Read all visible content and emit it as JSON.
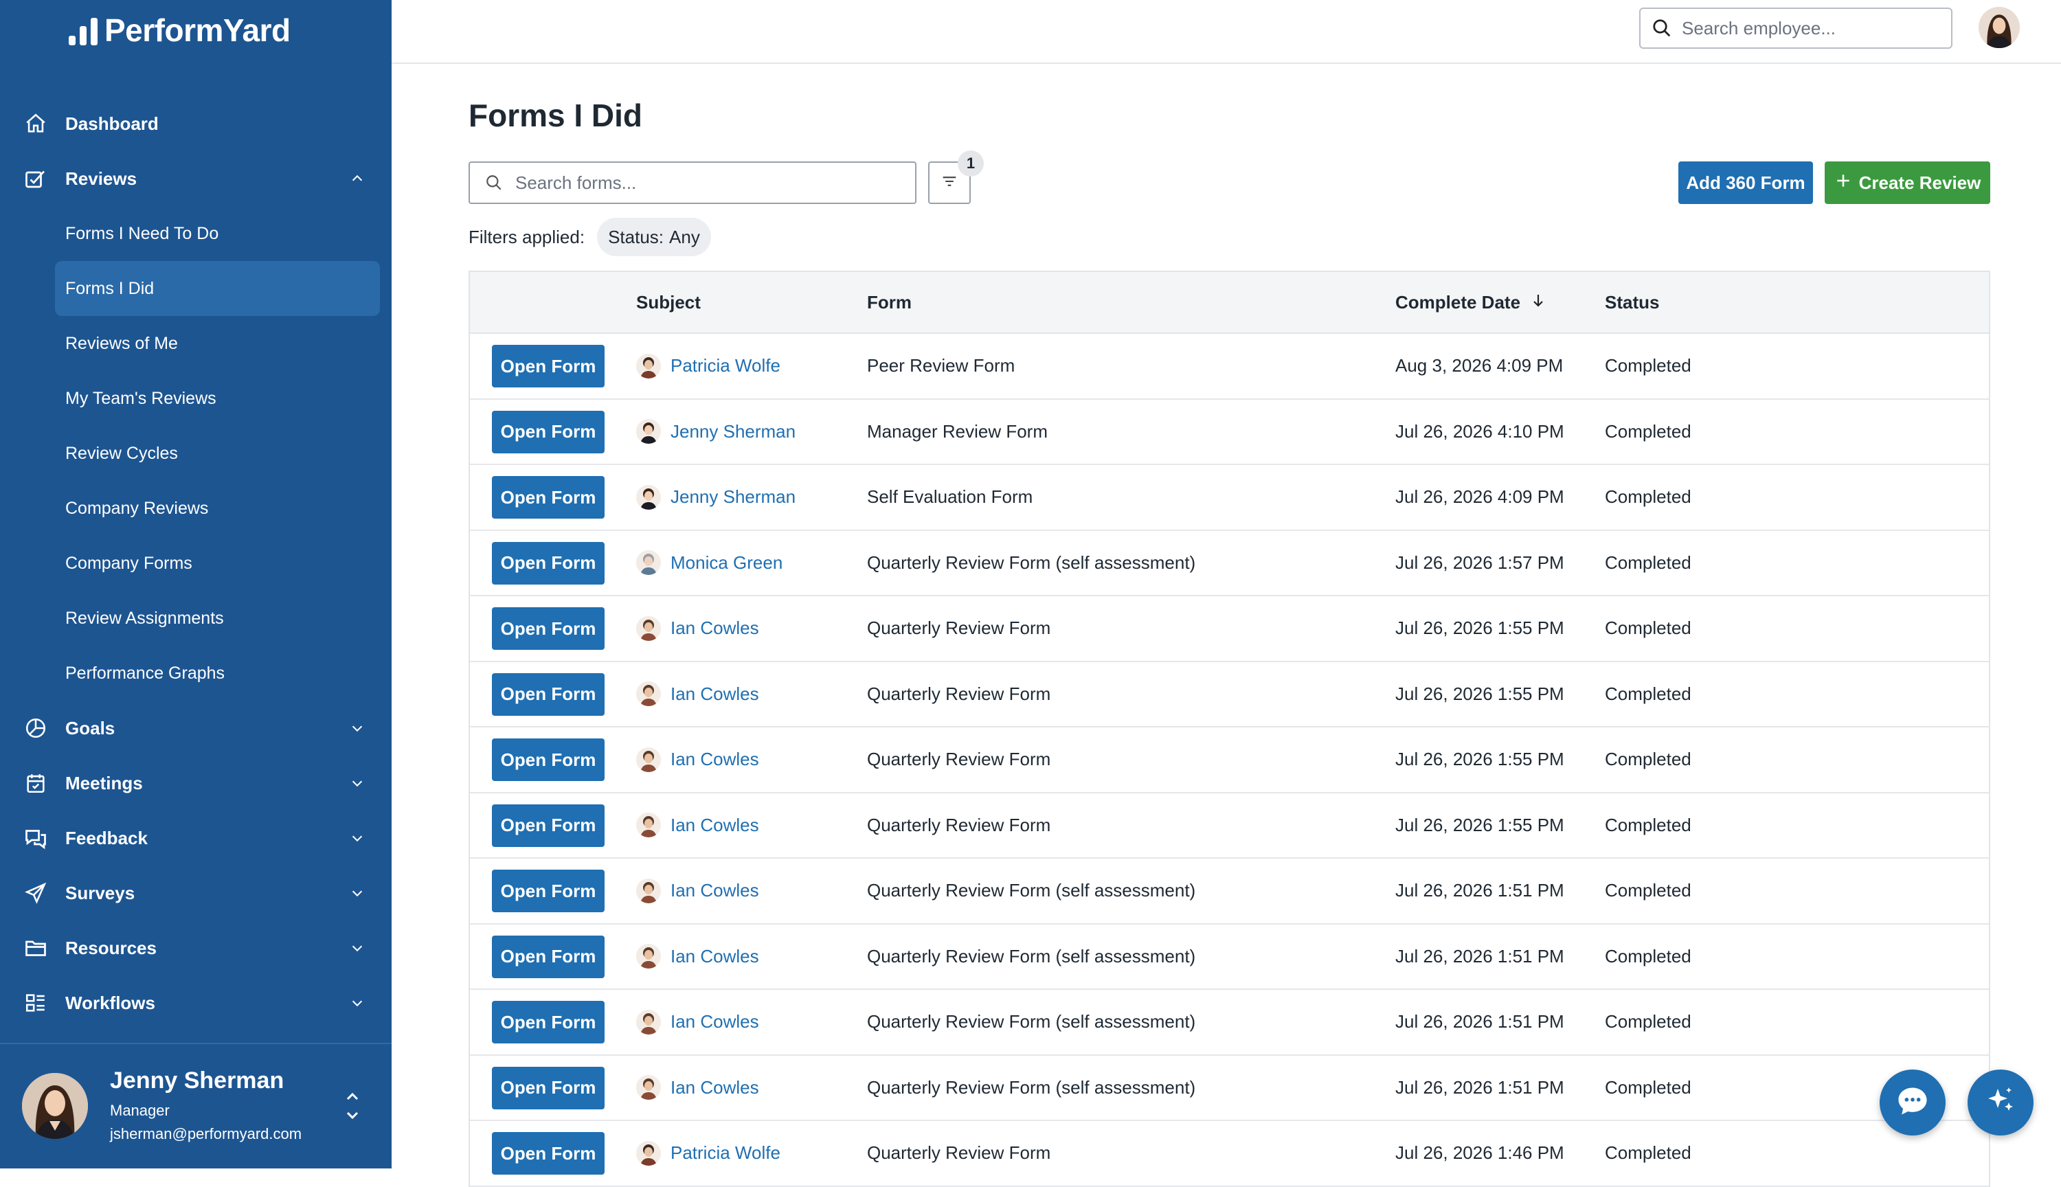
{
  "app": {
    "brand": "PerformYard"
  },
  "sidebar": {
    "items": [
      {
        "label": "Dashboard",
        "icon": "home-icon"
      },
      {
        "label": "Reviews",
        "icon": "reviews-icon",
        "expanded": true
      },
      {
        "label": "Goals",
        "icon": "goals-icon"
      },
      {
        "label": "Meetings",
        "icon": "calendar-icon"
      },
      {
        "label": "Feedback",
        "icon": "chat-icon"
      },
      {
        "label": "Surveys",
        "icon": "send-icon"
      },
      {
        "label": "Resources",
        "icon": "folder-icon"
      },
      {
        "label": "Workflows",
        "icon": "workflow-icon"
      }
    ],
    "reviews_sub": [
      "Forms I Need To Do",
      "Forms I Did",
      "Reviews of Me",
      "My Team's Reviews",
      "Review Cycles",
      "Company Reviews",
      "Company Forms",
      "Review Assignments",
      "Performance Graphs"
    ],
    "active_sub": "Forms I Did",
    "user": {
      "name": "Jenny Sherman",
      "role": "Manager",
      "email": "jsherman@performyard.com"
    }
  },
  "topbar": {
    "search_placeholder": "Search employee..."
  },
  "main": {
    "title": "Forms I Did",
    "search_placeholder": "Search forms...",
    "filter_count": "1",
    "add_360_label": "Add 360 Form",
    "create_review_label": "Create Review",
    "filters_applied_label": "Filters applied:",
    "filter_chip": {
      "key": "Status:",
      "value": "Any"
    }
  },
  "table": {
    "headers": {
      "subject": "Subject",
      "form": "Form",
      "complete_date": "Complete Date",
      "status": "Status"
    },
    "sort": {
      "column": "Complete Date",
      "direction": "descending"
    },
    "open_label": "Open Form",
    "rows": [
      {
        "subject": "Patricia Wolfe",
        "form": "Peer Review Form",
        "date": "Aug 3, 2026 4:09 PM",
        "status": "Completed"
      },
      {
        "subject": "Jenny Sherman",
        "form": "Manager Review Form",
        "date": "Jul 26, 2026 4:10 PM",
        "status": "Completed"
      },
      {
        "subject": "Jenny Sherman",
        "form": "Self Evaluation Form",
        "date": "Jul 26, 2026 4:09 PM",
        "status": "Completed"
      },
      {
        "subject": "Monica Green",
        "form": "Quarterly Review Form (self assessment)",
        "date": "Jul 26, 2026 1:57 PM",
        "status": "Completed"
      },
      {
        "subject": "Ian Cowles",
        "form": "Quarterly Review Form",
        "date": "Jul 26, 2026 1:55 PM",
        "status": "Completed"
      },
      {
        "subject": "Ian Cowles",
        "form": "Quarterly Review Form",
        "date": "Jul 26, 2026 1:55 PM",
        "status": "Completed"
      },
      {
        "subject": "Ian Cowles",
        "form": "Quarterly Review Form",
        "date": "Jul 26, 2026 1:55 PM",
        "status": "Completed"
      },
      {
        "subject": "Ian Cowles",
        "form": "Quarterly Review Form",
        "date": "Jul 26, 2026 1:55 PM",
        "status": "Completed"
      },
      {
        "subject": "Ian Cowles",
        "form": "Quarterly Review Form (self assessment)",
        "date": "Jul 26, 2026 1:51 PM",
        "status": "Completed"
      },
      {
        "subject": "Ian Cowles",
        "form": "Quarterly Review Form (self assessment)",
        "date": "Jul 26, 2026 1:51 PM",
        "status": "Completed"
      },
      {
        "subject": "Ian Cowles",
        "form": "Quarterly Review Form (self assessment)",
        "date": "Jul 26, 2026 1:51 PM",
        "status": "Completed"
      },
      {
        "subject": "Ian Cowles",
        "form": "Quarterly Review Form (self assessment)",
        "date": "Jul 26, 2026 1:51 PM",
        "status": "Completed"
      },
      {
        "subject": "Patricia Wolfe",
        "form": "Quarterly Review Form",
        "date": "Jul 26, 2026 1:46 PM",
        "status": "Completed"
      }
    ]
  },
  "colors": {
    "sidebar_bg": "#1d5591",
    "primary": "#1f6fb2",
    "success": "#3b9a3f"
  }
}
